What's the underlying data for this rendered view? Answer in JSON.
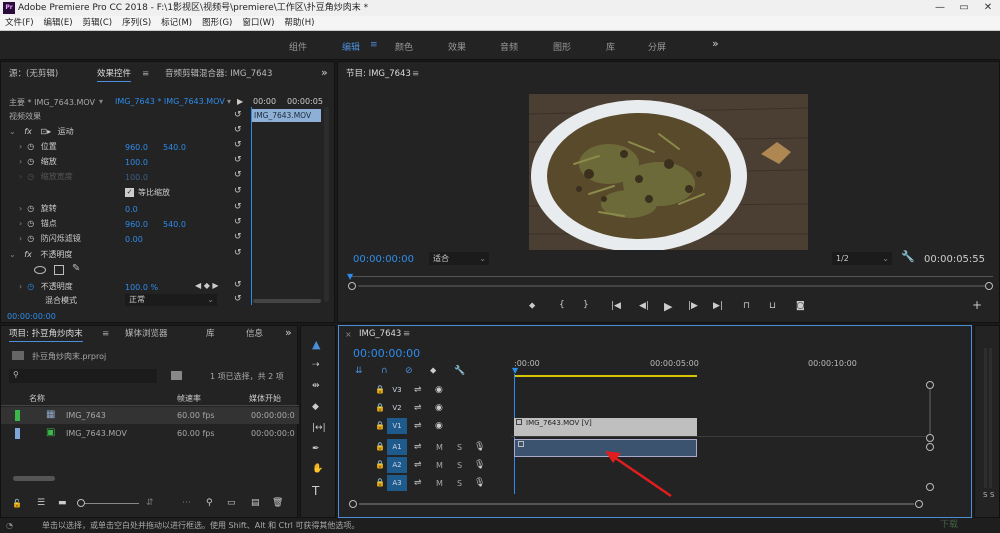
{
  "app": {
    "logo": "Pr",
    "title": "Adobe Premiere Pro CC 2018 - F:\\1影视区\\视频号\\premiere\\工作区\\扑豆角炒肉末 *"
  },
  "window_controls": {
    "minimize": "—",
    "maximize": "▭",
    "close": "✕"
  },
  "menu": [
    "文件(F)",
    "编辑(E)",
    "剪辑(C)",
    "序列(S)",
    "标记(M)",
    "图形(G)",
    "窗口(W)",
    "帮助(H)"
  ],
  "workspaces": {
    "items": [
      "组件",
      "编辑",
      "颜色",
      "效果",
      "音频",
      "图形",
      "库",
      "分屏"
    ],
    "active": "编辑",
    "menu_glyph": "≡",
    "more": "»"
  },
  "effect_controls": {
    "tabs": [
      "源：(无剪辑)",
      "效果控件",
      "音频剪辑混合器: IMG_7643"
    ],
    "more": "»",
    "clip_master": "主要 * IMG_7643.MOV",
    "clip_seq": "IMG_7643 * IMG_7643.MOV",
    "ruler_start": "00:00",
    "ruler_end": "00:00:05",
    "clip_bar": "IMG_7643.MOV",
    "section": "视频效果",
    "motion": "运动",
    "position_label": "位置",
    "position_x": "960.0",
    "position_y": "540.0",
    "scale_label": "缩放",
    "scale_value": "100.0",
    "scale_width_label": "缩放宽度",
    "scale_width_value": "100.0",
    "uniform_label": "等比缩放",
    "rotation_label": "旋转",
    "rotation_value": "0.0",
    "anchor_label": "锚点",
    "anchor_x": "960.0",
    "anchor_y": "540.0",
    "antiflicker_label": "防闪烁滤镜",
    "antiflicker_value": "0.00",
    "opacity_section": "不透明度",
    "opacity_label": "不透明度",
    "opacity_value": "100.0 %",
    "blend_label": "混合模式",
    "blend_value": "正常",
    "timecode": "00:00:00:00"
  },
  "program_monitor": {
    "title": "节目: IMG_7643",
    "menu_glyph": "≡",
    "timecode": "00:00:00:00",
    "fit": "适合",
    "resolution": "1/2",
    "duration": "00:00:05:55"
  },
  "project": {
    "tabs": [
      "项目: 扑豆角炒肉末",
      "媒体浏览器",
      "库",
      "信息"
    ],
    "more": "»",
    "file": "扑豆角炒肉末.prproj",
    "search_placeholder": "",
    "selection": "1 项已选择，共 2 项",
    "columns": [
      "名称",
      "帧速率",
      "媒体开始"
    ],
    "rows": [
      {
        "name": "IMG_7643",
        "fps": "60.00 fps",
        "start": "00:00:00:0",
        "color": "#3bb84a"
      },
      {
        "name": "IMG_7643.MOV",
        "fps": "60.00 fps",
        "start": "00:00:00:0",
        "color": "#7fa6d9"
      }
    ]
  },
  "timeline": {
    "title": "IMG_7643",
    "menu_glyph": "≡",
    "timecode": "00:00:00:00",
    "ruler": [
      ":00:00",
      "00:00:05:00",
      "00:00:10:00"
    ],
    "video_tracks": [
      "V3",
      "V2",
      "V1"
    ],
    "audio_tracks": [
      "A1",
      "A2",
      "A3"
    ],
    "v1_clip": "IMG_7643.MOV [V]",
    "ms": [
      "M",
      "S"
    ]
  },
  "meter": {
    "labels": [
      "S",
      "S"
    ]
  },
  "status": "单击以选择，或单击空白处并拖动以进行框选。使用 Shift、Alt 和 Ctrl 可获得其他选项。",
  "watermark": "下载"
}
